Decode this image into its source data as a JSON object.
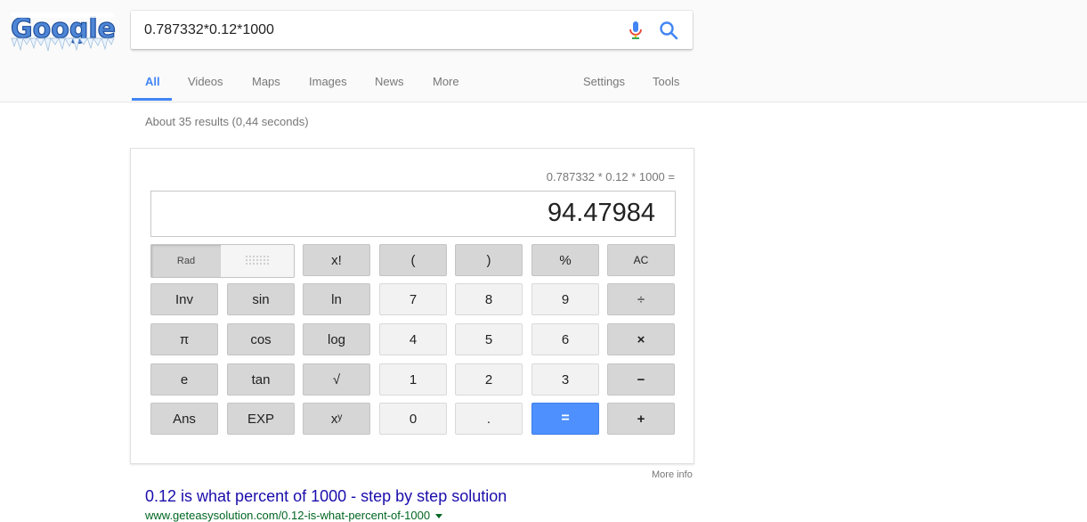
{
  "logo": {
    "text": "Google"
  },
  "search": {
    "query": "0.787332*0.12*1000"
  },
  "tabs": [
    {
      "label": "All"
    },
    {
      "label": "Videos"
    },
    {
      "label": "Maps"
    },
    {
      "label": "Images"
    },
    {
      "label": "News"
    },
    {
      "label": "More"
    }
  ],
  "tools": {
    "settings": "Settings",
    "tools": "Tools"
  },
  "stats": "About 35 results (0,44 seconds)",
  "calculator": {
    "expression": "0.787332 * 0.12 * 1000 =",
    "display": "94.47984",
    "rad_label": "Rad",
    "keys": {
      "fact": "x!",
      "lparen": "(",
      "rparen": ")",
      "percent": "%",
      "ac": "AC",
      "inv": "Inv",
      "sin": "sin",
      "ln": "ln",
      "seven": "7",
      "eight": "8",
      "nine": "9",
      "divide": "÷",
      "pi": "π",
      "cos": "cos",
      "log": "log",
      "four": "4",
      "five": "5",
      "six": "6",
      "multiply": "×",
      "e": "e",
      "tan": "tan",
      "sqrt": "√",
      "one": "1",
      "two": "2",
      "three": "3",
      "minus": "−",
      "ans": "Ans",
      "exp": "EXP",
      "power": "xʸ",
      "zero": "0",
      "dot": ".",
      "equals": "=",
      "plus": "+"
    }
  },
  "more_info": "More info",
  "first_result": {
    "title": "0.12 is what percent of 1000 - step by step solution",
    "url": "www.geteasysolution.com/0.12-is-what-percent-of-1000"
  },
  "colors": {
    "accent": "#4285f4",
    "link": "#1a0dab",
    "url": "#006621"
  }
}
